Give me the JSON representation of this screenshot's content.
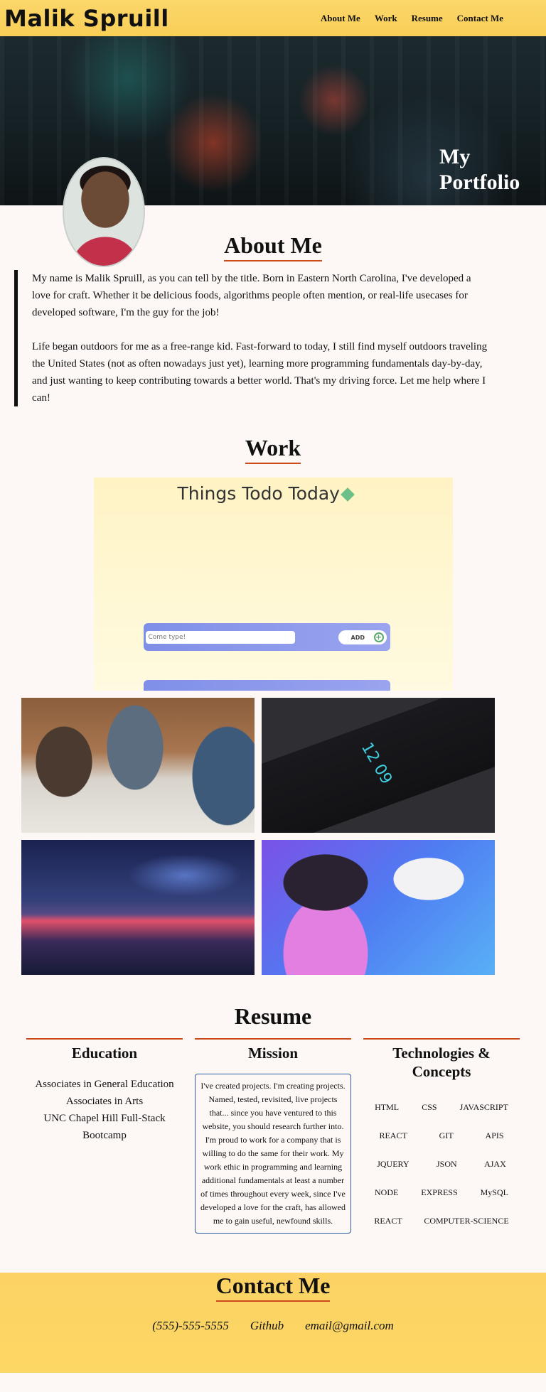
{
  "header": {
    "brand": "Malik Spruill",
    "nav": [
      "About Me",
      "Work",
      "Resume",
      "Contact Me"
    ]
  },
  "hero": {
    "title": "My Portfolio"
  },
  "about": {
    "title": "About Me",
    "paragraphs": [
      "My name is Malik Spruill, as you can tell by the title. Born in Eastern North Carolina, I've developed a love for craft. Whether it be delicious foods, algorithms people often mention, or real-life usecases for developed software, I'm the guy for the job!",
      "Life began outdoors for me as a free-range kid. Fast-forward to today, I still find myself outdoors traveling the United States (not as often nowadays just yet), learning more programming fundamentals day-by-day, and just wanting to keep contributing towards a better world. That's my driving force. Let me help where I can!"
    ]
  },
  "work": {
    "title": "Work",
    "todo": {
      "title": "Things Todo Today",
      "input_placeholder": "Come type!",
      "add_label": "ADD"
    },
    "gallery_clock": "12 09"
  },
  "resume": {
    "title": "Resume",
    "education": {
      "heading": "Education",
      "items": [
        "Associates in General Education",
        "Associates in Arts",
        "UNC Chapel Hill Full-Stack Bootcamp"
      ]
    },
    "mission": {
      "heading": "Mission",
      "text": "I've created projects. I'm creating projects. Named, tested, revisited, live projects that... since you have ventured to this website, you should research further into. I'm proud to work for a company that is willing to do the same for their work. My work ethic in programming and learning additional fundamentals at least a number of times throughout every week, since I've developed a love for the craft, has allowed me to gain useful, newfound skills."
    },
    "technologies": {
      "heading": "Technologies & Concepts",
      "items": [
        "HTML",
        "CSS",
        "JAVASCRIPT",
        "REACT",
        "GIT",
        "APIS",
        "JQUERY",
        "JSON",
        "AJAX",
        "NODE",
        "EXPRESS",
        "MySQL",
        "REACT",
        "COMPUTER-SCIENCE"
      ]
    }
  },
  "contact": {
    "title": "Contact Me",
    "phone": "(555)-555-5555",
    "github": "Github",
    "email": "email@gmail.com"
  }
}
